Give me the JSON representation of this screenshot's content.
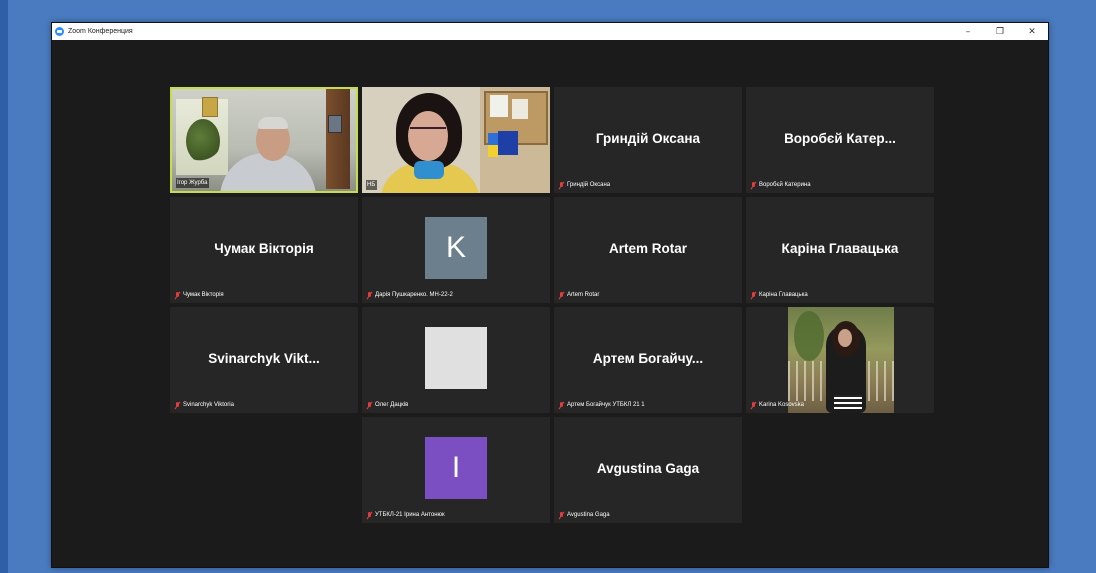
{
  "window": {
    "title": "Zoom Конференция",
    "controls": {
      "minimize": "–",
      "restore": "❐",
      "close": "✕"
    }
  },
  "colors": {
    "active_speaker_border": "#c6dc4a",
    "muted_icon": "#e23c3c",
    "avatar_k": "#6c7f8c",
    "avatar_blank": "#e0e0e0",
    "avatar_i": "#7b4fc2"
  },
  "participants": [
    {
      "kind": "video",
      "label": "Ігор Журба",
      "active_speaker": true
    },
    {
      "kind": "video",
      "label": "НБ",
      "active_speaker": false
    },
    {
      "kind": "name",
      "display_name": "Гриндій Оксана",
      "label": "Гриндій Оксана",
      "muted": true
    },
    {
      "kind": "name",
      "display_name": "Воробєй Катер...",
      "label": "Воробєй Катерина",
      "muted": true
    },
    {
      "kind": "name",
      "display_name": "Чумак Вікторія",
      "label": "Чумак Вікторія",
      "muted": true
    },
    {
      "kind": "avatar",
      "avatar_letter": "K",
      "label": "Дарія Пушкаренко. МН-22-2",
      "muted": true
    },
    {
      "kind": "name",
      "display_name": "Artem Rotar",
      "label": "Artem Rotar",
      "muted": true
    },
    {
      "kind": "name",
      "display_name": "Каріна Главацька",
      "label": "Каріна Главацька",
      "muted": true
    },
    {
      "kind": "name",
      "display_name": "Svinarchyk Vikt...",
      "label": "Svinarchyk Viktoria",
      "muted": true
    },
    {
      "kind": "avatar",
      "avatar_letter": "",
      "label": "Олег Дацків",
      "muted": true
    },
    {
      "kind": "name",
      "display_name": "Артем Богайчу...",
      "label": "Артем Богайчук УТБКЛ 21 1",
      "muted": true
    },
    {
      "kind": "photo",
      "label": "Karina Kosovska",
      "muted": true
    },
    {
      "kind": "avatar",
      "avatar_letter": "I",
      "label": "УТБКЛ-21 Ірина Антонюк",
      "muted": true
    },
    {
      "kind": "name",
      "display_name": "Avgustina Gaga",
      "label": "Avgustina Gaga",
      "muted": true
    }
  ]
}
